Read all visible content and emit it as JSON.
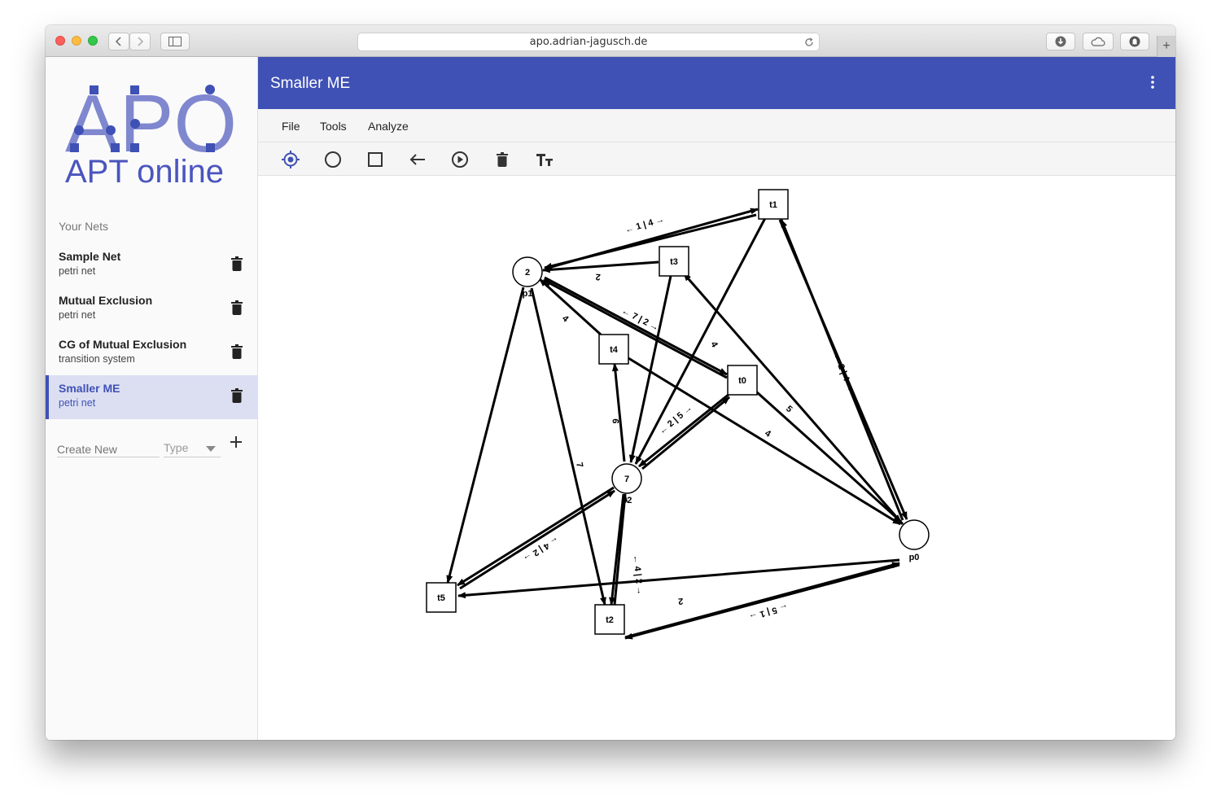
{
  "browser": {
    "url": "apo.adrian-jagusch.de"
  },
  "sidebar": {
    "logo_top": "APO",
    "logo_bottom": "APT online",
    "section_title": "Your Nets",
    "nets": [
      {
        "name": "Sample Net",
        "type": "petri net",
        "active": false
      },
      {
        "name": "Mutual Exclusion",
        "type": "petri net",
        "active": false
      },
      {
        "name": "CG of Mutual Exclusion",
        "type": "transition system",
        "active": false
      },
      {
        "name": "Smaller ME",
        "type": "petri net",
        "active": true
      }
    ],
    "create": {
      "placeholder": "Create New",
      "type_placeholder": "Type"
    }
  },
  "appbar": {
    "title": "Smaller ME"
  },
  "menu": {
    "items": [
      "File",
      "Tools",
      "Analyze"
    ]
  },
  "toolbar": {
    "tools": [
      "select-tool",
      "place-tool",
      "transition-tool",
      "arc-tool",
      "fire-tool",
      "delete-tool",
      "text-tool"
    ]
  },
  "graph": {
    "places": [
      {
        "id": "p1",
        "tokens": "2",
        "label": "p1"
      },
      {
        "id": "p2",
        "tokens": "7",
        "label": "p2"
      },
      {
        "id": "p0",
        "tokens": "",
        "label": "p0"
      }
    ],
    "transitions": [
      {
        "id": "t1",
        "label": "t1"
      },
      {
        "id": "t3",
        "label": "t3"
      },
      {
        "id": "t4",
        "label": "t4"
      },
      {
        "id": "t0",
        "label": "t0"
      },
      {
        "id": "t5",
        "label": "t5"
      },
      {
        "id": "t2",
        "label": "t2"
      }
    ],
    "arc_labels": [
      "← 1 | 4 →",
      "2",
      "4",
      "← 7 | 2 →",
      "4",
      "← 2 | 4 →",
      "6",
      "← 2 | 5 →",
      "5",
      "4",
      "7",
      "← 4 | 2 →",
      "← 4 | 2 →",
      "2",
      "← 5 | 1 →"
    ]
  },
  "colors": {
    "brand": "#3f51b5",
    "active_item_bg": "#dcdff2",
    "logo": "#5b66c2"
  }
}
